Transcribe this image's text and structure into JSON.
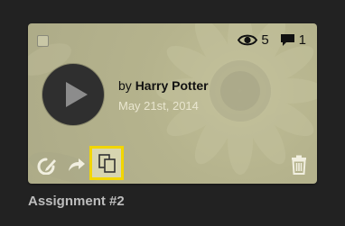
{
  "card": {
    "views": "5",
    "comments": "1",
    "by_prefix": "by ",
    "author": "Harry Potter",
    "date": "May 21st, 2014"
  },
  "title": "Assignment #2",
  "colors": {
    "highlight": "#f2d600",
    "card_bg": "#b5b38d",
    "page_bg": "#222222"
  }
}
